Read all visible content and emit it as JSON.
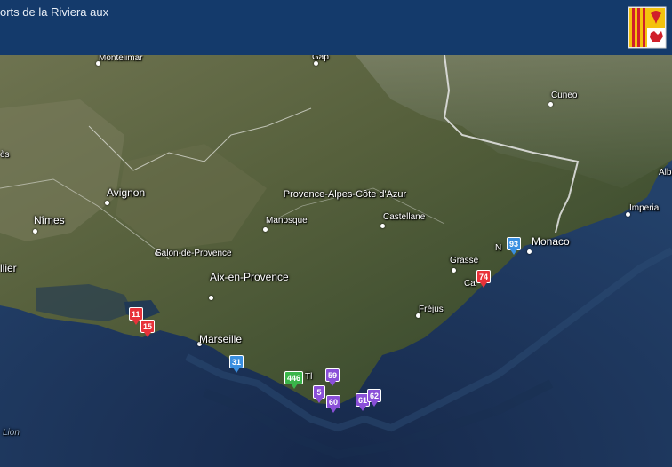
{
  "header": {
    "title": "orts de la Riviera aux"
  },
  "colors": {
    "sea": "#1d3656",
    "land": "#4a5a38",
    "header": "#143a6b",
    "marker_red": "#e8323a",
    "marker_blue": "#3a8fe0",
    "marker_green": "#3ab54a",
    "marker_purple": "#8a4fd8"
  },
  "places": [
    {
      "id": "montelimar",
      "label": "Montélimar"
    },
    {
      "id": "gap",
      "label": "Gap"
    },
    {
      "id": "cuneo",
      "label": "Cuneo"
    },
    {
      "id": "nimes_frag",
      "label": "ès"
    },
    {
      "id": "avignon",
      "label": "Avignon"
    },
    {
      "id": "nimes",
      "label": "Nîmes"
    },
    {
      "id": "region",
      "label": "Provence-Alpes-Côte d'Azur"
    },
    {
      "id": "manosque",
      "label": "Manosque"
    },
    {
      "id": "castellane",
      "label": "Castellane"
    },
    {
      "id": "salon",
      "label": "Salon-de-Provence"
    },
    {
      "id": "aix",
      "label": "Aix-en-Provence"
    },
    {
      "id": "lier",
      "label": "llier"
    },
    {
      "id": "grasse",
      "label": "Grasse"
    },
    {
      "id": "monaco",
      "label": "Monaco"
    },
    {
      "id": "imperia",
      "label": "Imperia"
    },
    {
      "id": "albenga",
      "label": "Albe"
    },
    {
      "id": "nice",
      "label": "N"
    },
    {
      "id": "cannes",
      "label": "Ca"
    },
    {
      "id": "frejus",
      "label": "Fréjus"
    },
    {
      "id": "marseille",
      "label": "Marseille"
    },
    {
      "id": "toulon",
      "label": "Tl"
    },
    {
      "id": "lion",
      "label": "Lion"
    }
  ],
  "markers": [
    {
      "id": "m11",
      "label": "11",
      "color": "red"
    },
    {
      "id": "m15",
      "label": "15",
      "color": "red"
    },
    {
      "id": "m31",
      "label": "31",
      "color": "blue"
    },
    {
      "id": "m446",
      "label": "446",
      "color": "green"
    },
    {
      "id": "m59",
      "label": "59",
      "color": "purple"
    },
    {
      "id": "m5",
      "label": "5",
      "color": "purple"
    },
    {
      "id": "m60",
      "label": "60",
      "color": "purple"
    },
    {
      "id": "m61",
      "label": "61",
      "color": "purple"
    },
    {
      "id": "m62",
      "label": "62",
      "color": "purple"
    },
    {
      "id": "m74",
      "label": "74",
      "color": "red"
    },
    {
      "id": "m93",
      "label": "93",
      "color": "blue"
    }
  ]
}
